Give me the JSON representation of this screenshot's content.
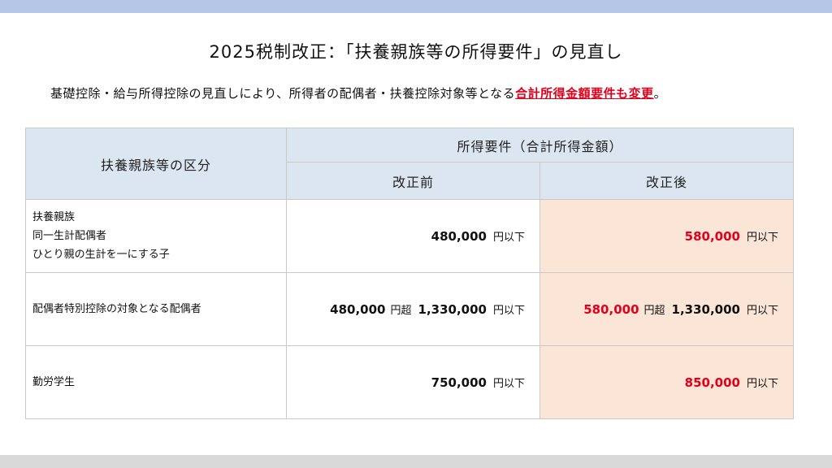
{
  "title": "2025税制改正：「扶養親族等の所得要件」の見直し",
  "subtitle": {
    "text": "基礎控除・給与所得控除の見直しにより、所得者の配偶者・扶養控除対象等となる",
    "emphasis": "合計所得金額要件も変更",
    "end": "。"
  },
  "table": {
    "category_header": "扶養親族等の区分",
    "requirement_header": "所得要件（合計所得金額）",
    "before_header": "改正前",
    "after_header": "改正後",
    "rows": [
      {
        "category_lines": [
          "扶養親族",
          "同一生計配偶者",
          "ひとり親の生計を一にする子"
        ],
        "before": {
          "amount": "480,000",
          "unit": "円以下"
        },
        "after": {
          "amount": "580,000",
          "unit": "円以下"
        }
      },
      {
        "category_lines": [
          "配偶者特別控除の対象となる配偶者"
        ],
        "before": {
          "lower": "480,000",
          "over": "円超",
          "upper": "1,330,000",
          "unit": "円以下"
        },
        "after": {
          "lower": "580,000",
          "over": "円超",
          "upper": "1,330,000",
          "unit": "円以下"
        }
      },
      {
        "category_lines": [
          "勤労学生"
        ],
        "before": {
          "amount": "750,000",
          "unit": "円以下"
        },
        "after": {
          "amount": "850,000",
          "unit": "円以下"
        }
      }
    ]
  },
  "colors": {
    "top_bar": "#b4c7e7",
    "bottom_bar": "#d9d9d9",
    "header_bg": "#dce6f1",
    "after_bg": "#fbe5d6",
    "accent_red": "#e0001b"
  }
}
